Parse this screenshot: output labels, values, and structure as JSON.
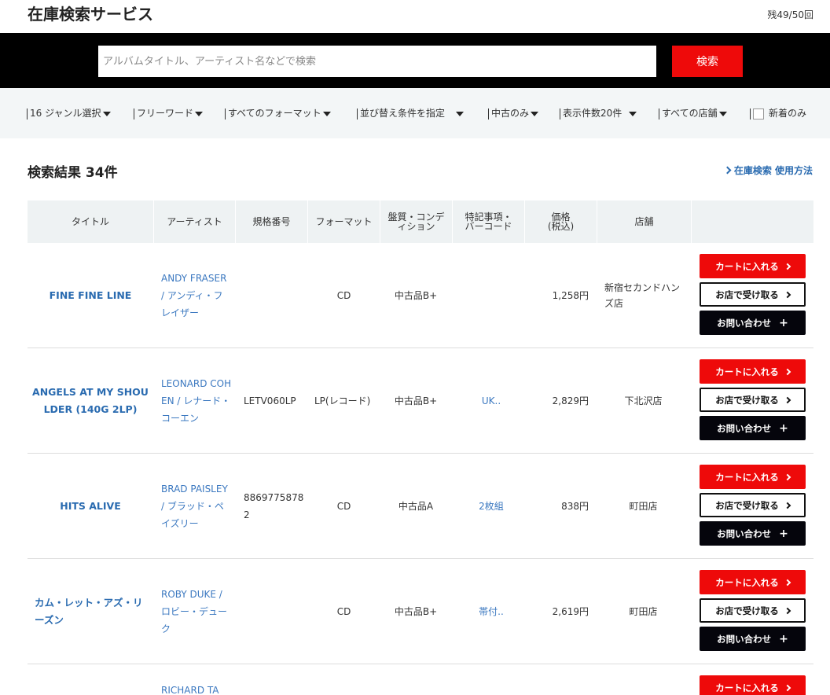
{
  "header": {
    "title": "在庫検索サービス",
    "remaining": "残49/50回"
  },
  "search": {
    "placeholder": "アルバムタイトル、アーティスト名などで検索",
    "value": "",
    "button_label": "検索"
  },
  "filters": {
    "genre": "16 ジャンル選択",
    "freeword": "フリーワード",
    "format": "すべてのフォーマット",
    "sort": "並び替え条件を指定",
    "used_only": "中古のみ",
    "page_size": "表示件数20件",
    "stores": "すべての店舗",
    "new_arrivals": "新着のみ"
  },
  "results": {
    "title": "検索結果 34件",
    "howto_link": "在庫検索 使用方法"
  },
  "table": {
    "headers": {
      "title": "タイトル",
      "artist": "アーティスト",
      "code": "規格番号",
      "format": "フォーマット",
      "condition": "盤質・コンデ\nィション",
      "notes": "特記事項・\nバーコード",
      "price": "価格\n(税込)",
      "store": "店舗"
    },
    "actions": {
      "cart": "カートに入れる",
      "pickup": "お店で受け取る",
      "inquiry": "お問い合わせ"
    },
    "rows": [
      {
        "title": "FINE FINE LINE",
        "artist": "ANDY FRASER / アンディ・フレイザー",
        "code": "",
        "format": "CD",
        "condition": "中古品B+",
        "notes": "",
        "price": "1,258円",
        "store": "新宿セカンドハンズ店"
      },
      {
        "title": "ANGELS AT MY SHOULDER (140G 2LP)",
        "artist": "LEONARD COHEN / レナード・コーエン",
        "code": "LETV060LP",
        "format": "LP(レコード)",
        "condition": "中古品B+",
        "notes": "UK..",
        "price": "2,829円",
        "store": "下北沢店"
      },
      {
        "title": "HITS ALIVE",
        "artist": "BRAD PAISLEY / ブラッド・ペイズリー",
        "code": "88697758782",
        "format": "CD",
        "condition": "中古品A",
        "notes": "2枚組",
        "price": "838円",
        "store": "町田店"
      },
      {
        "title": "カム・レット・アズ・リーズン",
        "artist": "ROBY DUKE / ロビー・デューク",
        "code": "",
        "format": "CD",
        "condition": "中古品B+",
        "notes": "帯付..",
        "price": "2,619円",
        "store": "町田店"
      },
      {
        "title": "",
        "artist": "RICHARD TA",
        "code": "",
        "format": "",
        "condition": "",
        "notes": "",
        "price": "",
        "store": ""
      }
    ]
  },
  "colors": {
    "accent_red": "#ee0a0a",
    "link_blue": "#2a6bb0",
    "header_bg": "#000000",
    "filter_bg": "#f3f6f7"
  }
}
